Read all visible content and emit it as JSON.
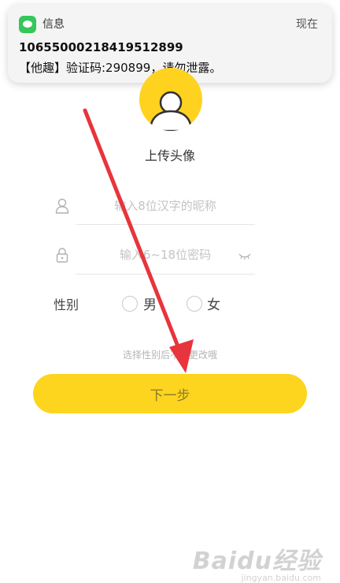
{
  "notification": {
    "app_name": "信息",
    "time": "现在",
    "sender": "10655000218419512899",
    "body": "【他趣】验证码:290899，请勿泄露。"
  },
  "avatar": {
    "upload_label": "上传头像"
  },
  "form": {
    "nickname": {
      "placeholder": "输入8位汉字的昵称",
      "value": ""
    },
    "password": {
      "placeholder": "输入6~18位密码",
      "value": ""
    },
    "gender": {
      "label": "性别",
      "male": "男",
      "female": "女",
      "hint": "选择性别后不可更改哦"
    },
    "next_button": "下一步"
  },
  "watermark": {
    "brand": "Baidu经验",
    "url": "jingyan.baidu.com"
  },
  "colors": {
    "accent": "#fdd41e",
    "arrow": "#e8343c",
    "notification_app": "#34c759"
  }
}
